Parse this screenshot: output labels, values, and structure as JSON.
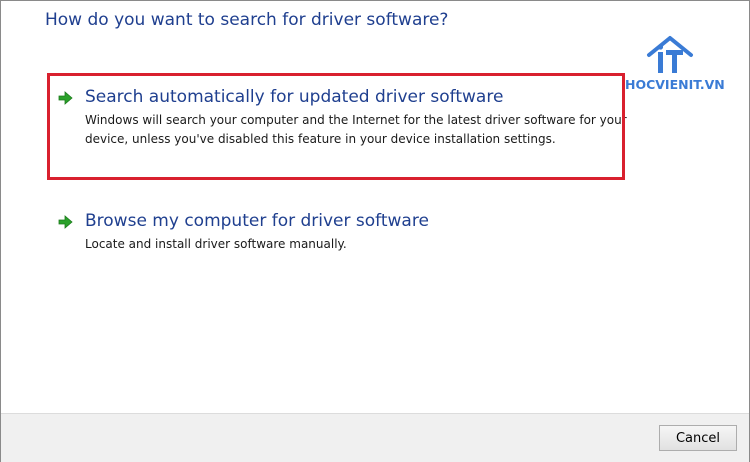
{
  "dialog": {
    "heading": "How do you want to search for driver software?"
  },
  "options": [
    {
      "title": "Search automatically for updated driver software",
      "description": "Windows will search your computer and the Internet for the latest driver software for your device, unless you've disabled this feature in your device installation settings.",
      "icon": "green-arrow-icon",
      "highlighted": true,
      "highlight_color": "#d9202e"
    },
    {
      "title": "Browse my computer for driver software",
      "description": "Locate and install driver software manually.",
      "icon": "green-arrow-icon",
      "highlighted": false
    }
  ],
  "watermark": {
    "logo_text": "iT",
    "site": "HOCVIENIT.VN",
    "color": "#3a7bd5"
  },
  "footer": {
    "cancel_label": "Cancel"
  },
  "colors": {
    "heading": "#1f3f8f",
    "arrow": "#2aa12a"
  }
}
